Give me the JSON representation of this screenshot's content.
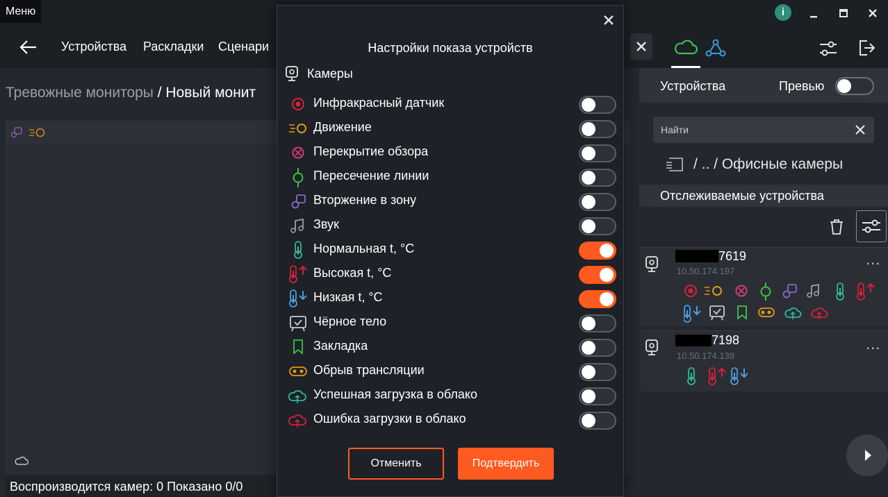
{
  "titlebar": {
    "menu_label": "Меню",
    "info_label": "i"
  },
  "nav": {
    "items": [
      "Устройства",
      "Раскладки",
      "Сценари"
    ]
  },
  "breadcrumb": {
    "parent": "Тревожные мониторы",
    "separator": " / ",
    "current": "Новый монит"
  },
  "statusbar": {
    "text": "Воспроизводится камер: 0  Показано 0/0"
  },
  "right_panel": {
    "devices_label": "Устройства",
    "preview_label": "Превью",
    "search_placeholder": "Найти",
    "path_text": "/ .. / Офисные камеры",
    "tracked_label": "Отслеживаемые устройства",
    "devices": [
      {
        "name_suffix": "7619",
        "ip": "10.50.174.197",
        "dots": "..."
      },
      {
        "name_suffix": "7198",
        "ip": "10.50.174.139",
        "dots": "..."
      }
    ]
  },
  "dialog": {
    "title": "Настройки показа устройств",
    "section_label": "Камеры",
    "options": [
      {
        "label": "Инфракрасный датчик",
        "icon": "infrared-icon",
        "enabled": false
      },
      {
        "label": "Движение",
        "icon": "motion-icon",
        "enabled": false
      },
      {
        "label": "Перекрытие обзора",
        "icon": "view-blocked-icon",
        "enabled": false
      },
      {
        "label": "Пересечение линии",
        "icon": "line-cross-icon",
        "enabled": false
      },
      {
        "label": "Вторжение в зону",
        "icon": "zone-intrusion-icon",
        "enabled": false
      },
      {
        "label": "Звук",
        "icon": "sound-icon",
        "enabled": false
      },
      {
        "label": "Нормальная t, °C",
        "icon": "normal-temp-icon",
        "enabled": true
      },
      {
        "label": "Высокая t, °C",
        "icon": "high-temp-icon",
        "enabled": true
      },
      {
        "label": "Низкая t, °C",
        "icon": "low-temp-icon",
        "enabled": true
      },
      {
        "label": "Чёрное тело",
        "icon": "black-body-icon",
        "enabled": false
      },
      {
        "label": "Закладка",
        "icon": "bookmark-icon",
        "enabled": false
      },
      {
        "label": "Обрыв трансляции",
        "icon": "stream-break-icon",
        "enabled": false
      },
      {
        "label": "Успешная загрузка в облако",
        "icon": "cloud-upload-ok-icon",
        "enabled": false
      },
      {
        "label": "Ошибка загрузки в облако",
        "icon": "cloud-upload-error-icon",
        "enabled": false
      }
    ],
    "cancel_label": "Отменить",
    "confirm_label": "Подтвердить"
  },
  "colors": {
    "accent": "#ff5a1f",
    "cloud_tab": "#3ec24a",
    "network_tab": "#3a9ad9",
    "info_badge": "#2f8e7d"
  }
}
